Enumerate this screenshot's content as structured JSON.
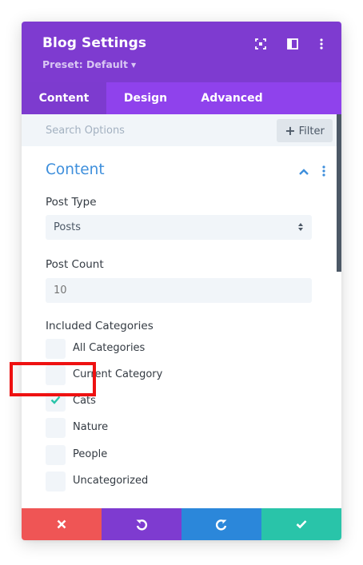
{
  "header": {
    "title": "Blog Settings",
    "preset_label": "Preset: Default",
    "icons": [
      "expand-icon",
      "sidebar-layout-icon",
      "kebab-menu-icon"
    ],
    "color": "#7e3bd0"
  },
  "tabs": [
    {
      "label": "Content",
      "active": true
    },
    {
      "label": "Design",
      "active": false
    },
    {
      "label": "Advanced",
      "active": false
    }
  ],
  "search": {
    "placeholder": "Search Options",
    "value": "",
    "filter_label": "Filter"
  },
  "section": {
    "title": "Content",
    "expanded": true,
    "accent": "#3e8fdc"
  },
  "fields": {
    "post_type": {
      "label": "Post Type",
      "value": "Posts"
    },
    "post_count": {
      "label": "Post Count",
      "placeholder": "10",
      "value": ""
    },
    "included_categories": {
      "label": "Included Categories",
      "options": [
        {
          "label": "All Categories",
          "checked": false
        },
        {
          "label": "Current Category",
          "checked": false
        },
        {
          "label": "Cats",
          "checked": true
        },
        {
          "label": "Nature",
          "checked": false
        },
        {
          "label": "People",
          "checked": false
        },
        {
          "label": "Uncategorized",
          "checked": false
        }
      ]
    }
  },
  "footer": {
    "buttons": [
      {
        "name": "cancel-button",
        "icon": "close-icon",
        "color": "#ef5555"
      },
      {
        "name": "undo-button",
        "icon": "undo-icon",
        "color": "#7e3bd0"
      },
      {
        "name": "redo-button",
        "icon": "redo-icon",
        "color": "#2b87da"
      },
      {
        "name": "save-button",
        "icon": "check-icon",
        "color": "#29c4a9"
      }
    ]
  },
  "colors": {
    "highlight": "#ee1111",
    "checkmark": "#29c4a9"
  }
}
